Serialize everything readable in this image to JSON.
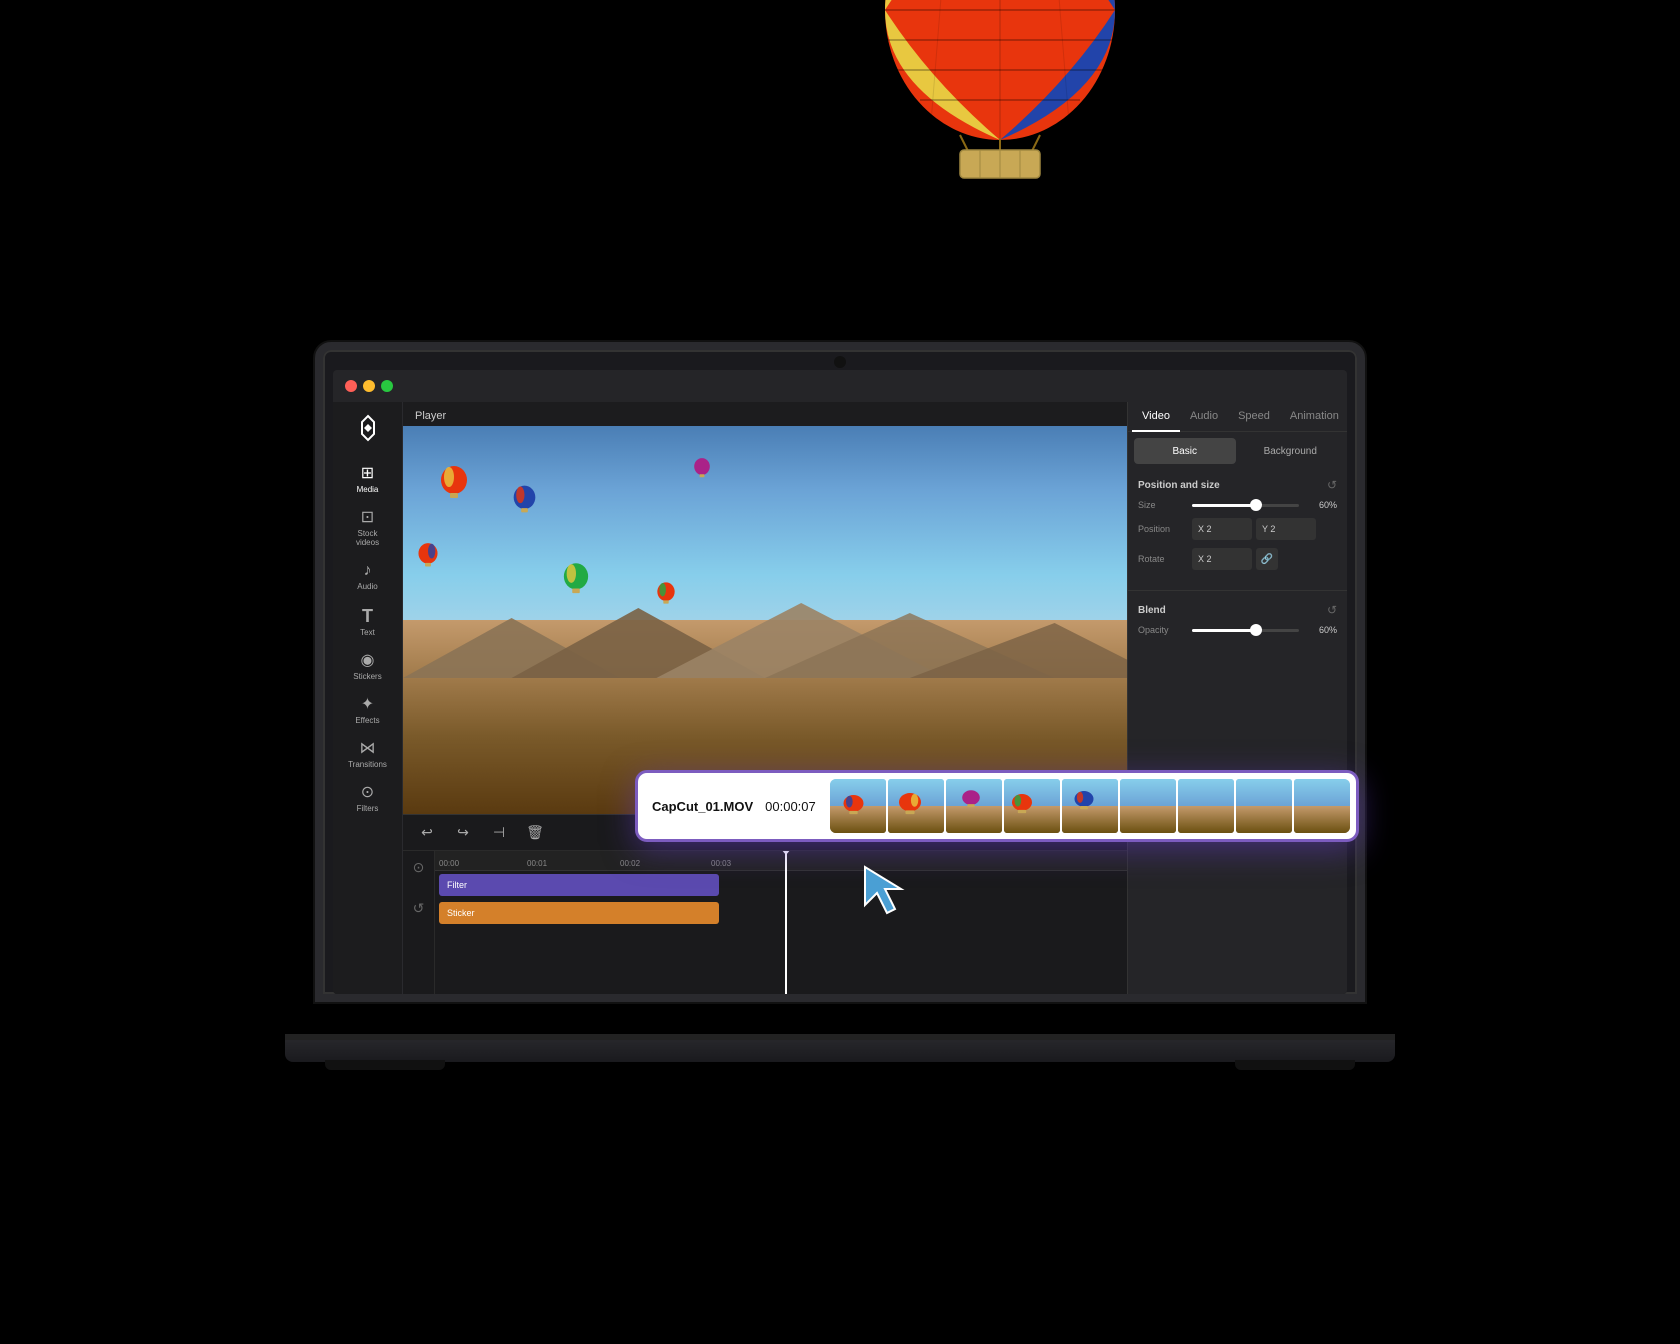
{
  "app": {
    "title": "CapCut",
    "traffic_lights": {
      "close": "#ff5f57",
      "minimize": "#febc2e",
      "maximize": "#28c840"
    }
  },
  "sidebar": {
    "logo_label": "CapCut Logo",
    "items": [
      {
        "id": "media",
        "label": "Media",
        "icon": "⊞",
        "active": true
      },
      {
        "id": "stock",
        "label": "Stock videos",
        "icon": "⊡"
      },
      {
        "id": "audio",
        "label": "Audio",
        "icon": "♪"
      },
      {
        "id": "text",
        "label": "Text",
        "icon": "T"
      },
      {
        "id": "stickers",
        "label": "Stickers",
        "icon": "◉"
      },
      {
        "id": "effects",
        "label": "Effects",
        "icon": "✦"
      },
      {
        "id": "transitions",
        "label": "Transitions",
        "icon": "⋈"
      },
      {
        "id": "filters",
        "label": "Filters",
        "icon": "⊙"
      }
    ]
  },
  "player": {
    "label": "Player"
  },
  "right_panel": {
    "tabs": [
      {
        "id": "video",
        "label": "Video",
        "active": true
      },
      {
        "id": "audio",
        "label": "Audio"
      },
      {
        "id": "speed",
        "label": "Speed"
      },
      {
        "id": "animation",
        "label": "Animation"
      }
    ],
    "sub_tabs": [
      {
        "id": "basic",
        "label": "Basic",
        "active": true
      },
      {
        "id": "background",
        "label": "Background"
      }
    ],
    "position_size": {
      "title": "Position and size",
      "size_label": "Size",
      "size_value": 60,
      "size_percent": "60%",
      "position_label": "Position",
      "position_x": "X  2",
      "position_y": "Y  2",
      "rotate_label": "Rotate",
      "rotate_x": "X  2"
    },
    "blend": {
      "title": "Blend",
      "opacity_label": "Opacity",
      "opacity_value": 60,
      "opacity_percent": "60%"
    }
  },
  "timeline": {
    "toolbar_buttons": [
      "↩",
      "↪",
      "⊣",
      "🗑"
    ],
    "ruler_marks": [
      "00:00",
      "00:01",
      "00:02",
      "00:03"
    ],
    "tracks": [
      {
        "id": "filter",
        "label": "Filter",
        "color": "#5b4aaf"
      },
      {
        "id": "sticker",
        "label": "Sticker",
        "color": "#d4802a"
      }
    ]
  },
  "clip_tooltip": {
    "filename": "CapCut_01.MOV",
    "duration": "00:00:07"
  },
  "colors": {
    "accent_purple": "#7c5cbf",
    "accent_orange": "#d4802a",
    "bg_dark": "#1c1c1e",
    "bg_panel": "#252528",
    "text_primary": "#ffffff",
    "text_secondary": "#888888"
  }
}
